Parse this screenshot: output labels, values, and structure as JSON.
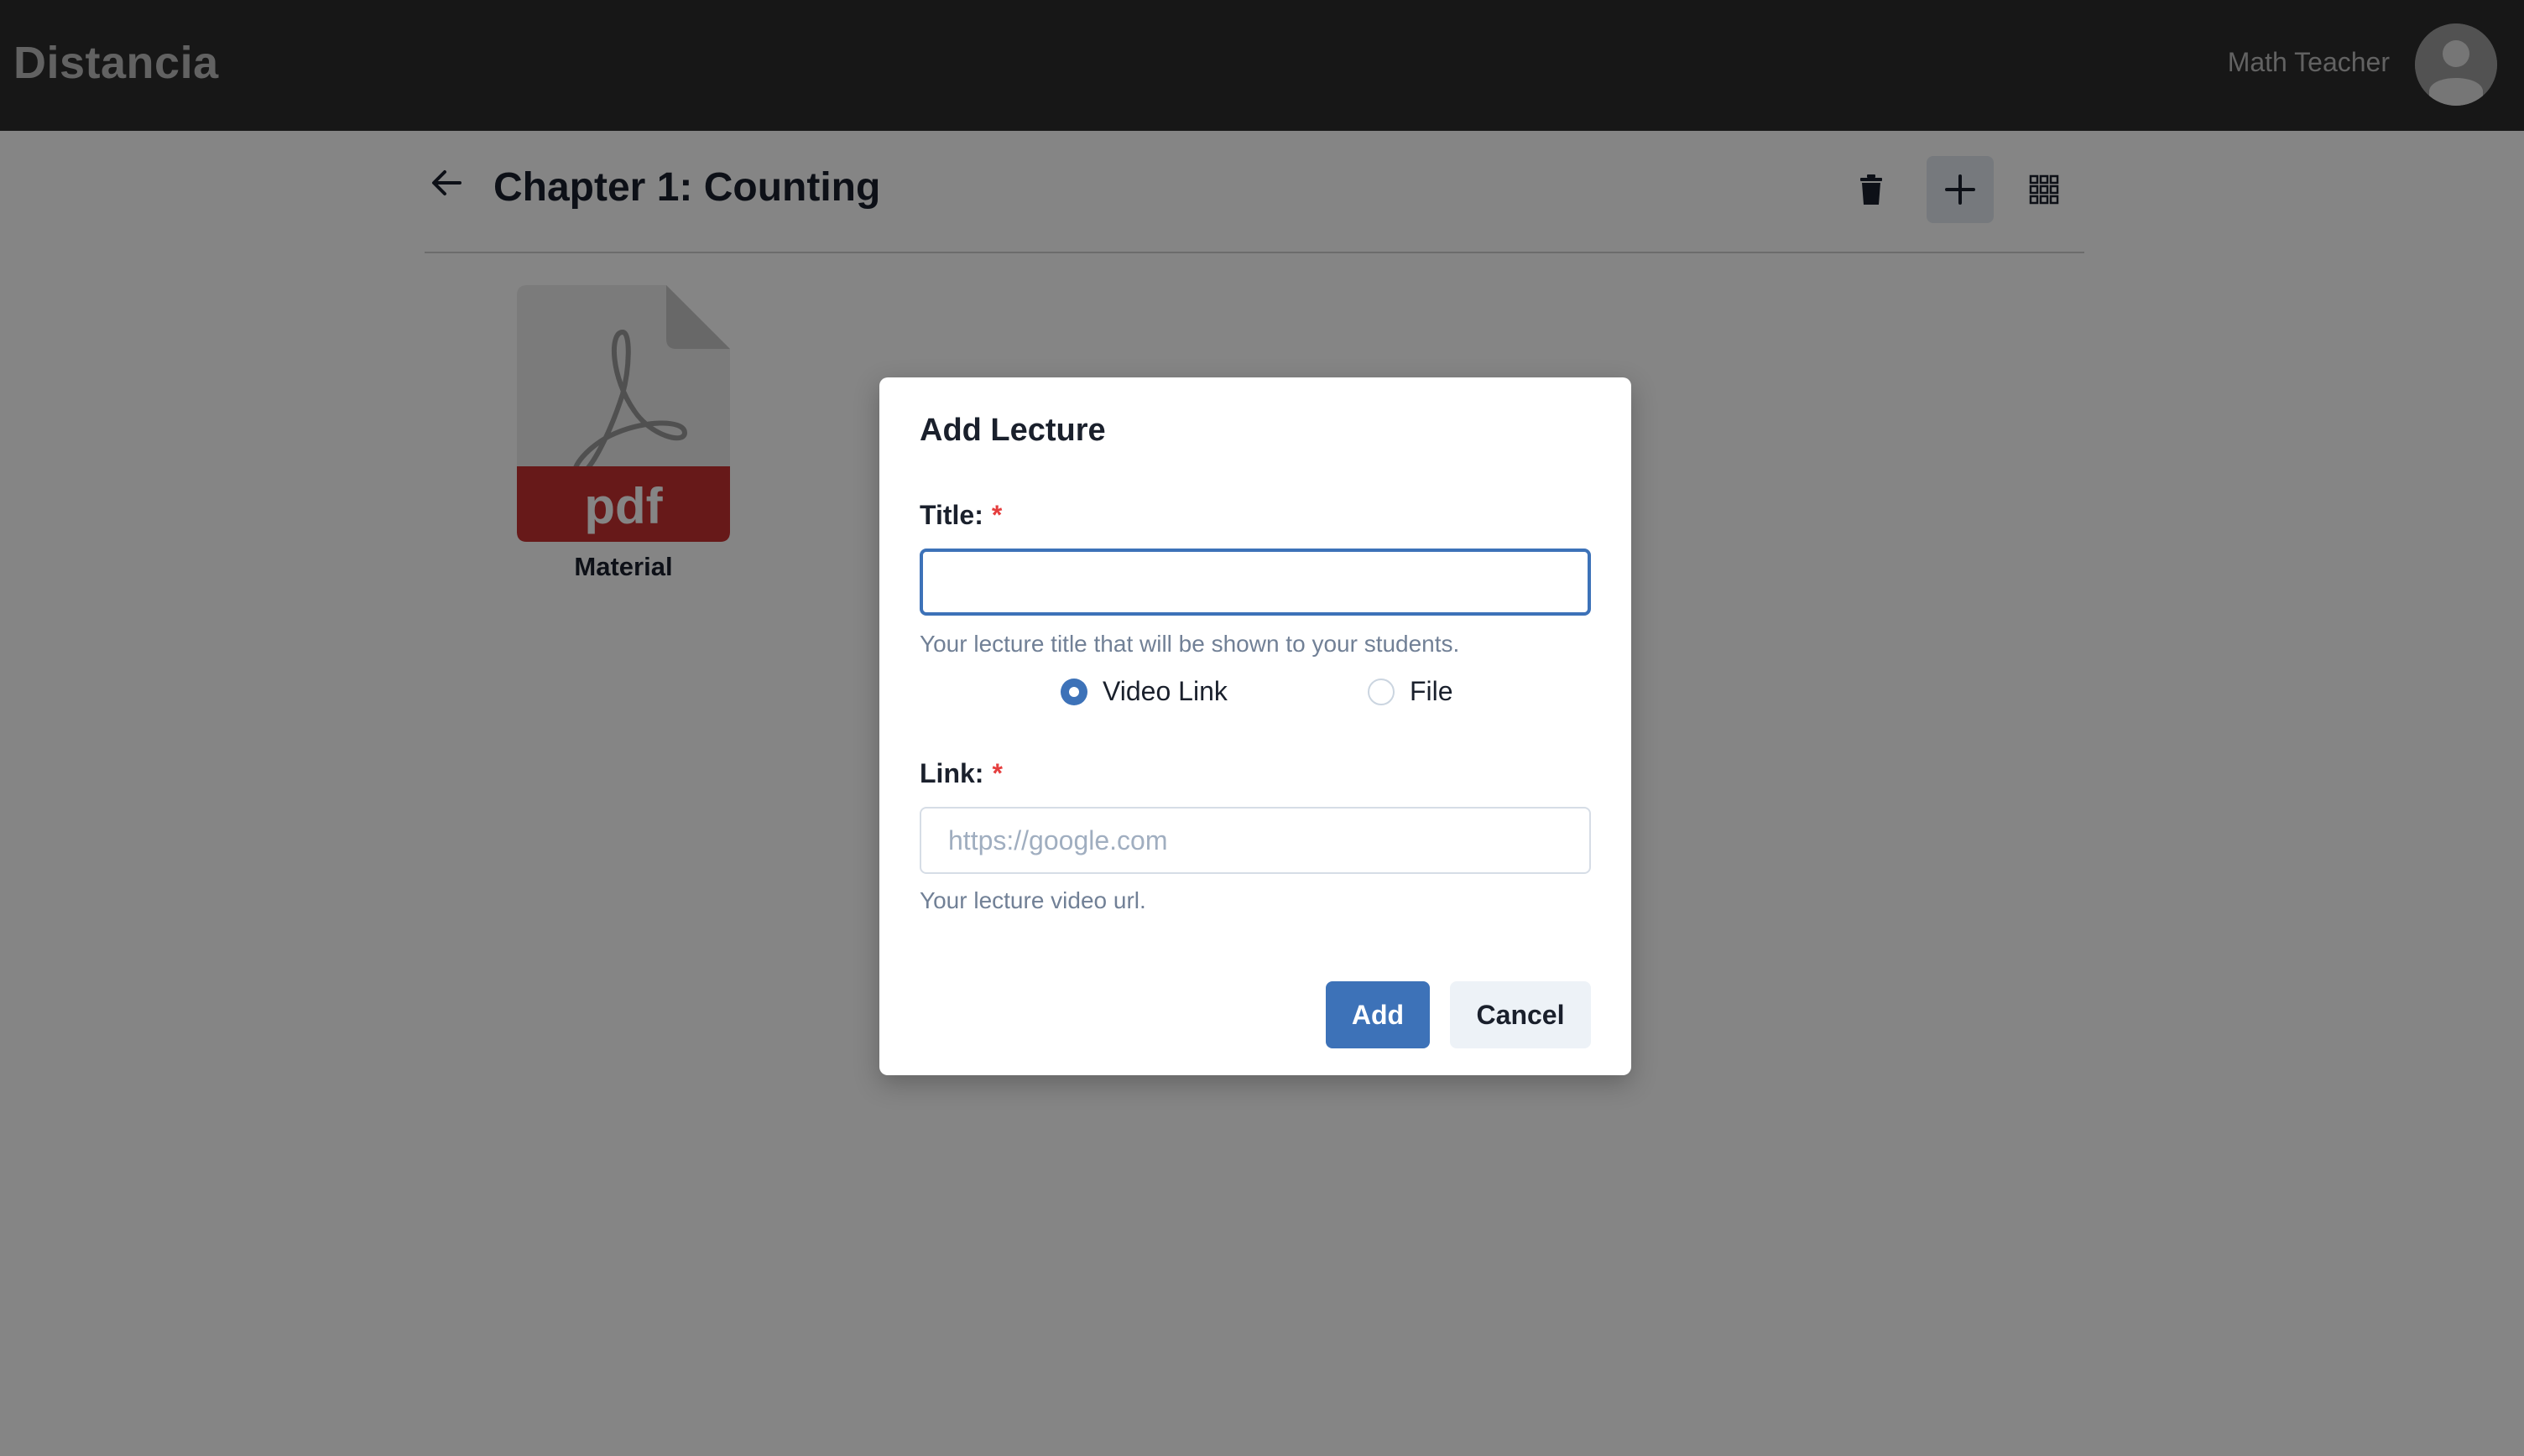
{
  "app": {
    "brand": "Distancia"
  },
  "user": {
    "name": "Math Teacher"
  },
  "page": {
    "title": "Chapter 1: Counting"
  },
  "materials": [
    {
      "label": "Material",
      "type_badge": "pdf"
    }
  ],
  "modal": {
    "title": "Add Lecture",
    "title_field": {
      "label": "Title:",
      "required_mark": "*",
      "value": "",
      "helper": "Your lecture title that will be shown to your students."
    },
    "type_options": [
      {
        "label": "Video Link",
        "selected": true
      },
      {
        "label": "File",
        "selected": false
      }
    ],
    "link_field": {
      "label": "Link:",
      "required_mark": "*",
      "placeholder": "https://google.com",
      "helper": "Your lecture video url."
    },
    "buttons": {
      "add": "Add",
      "cancel": "Cancel"
    }
  },
  "colors": {
    "accent": "#3d72b8",
    "required": "#e53e3e",
    "pdf_badge": "#c53030",
    "topbar": "#2c2c2c"
  }
}
